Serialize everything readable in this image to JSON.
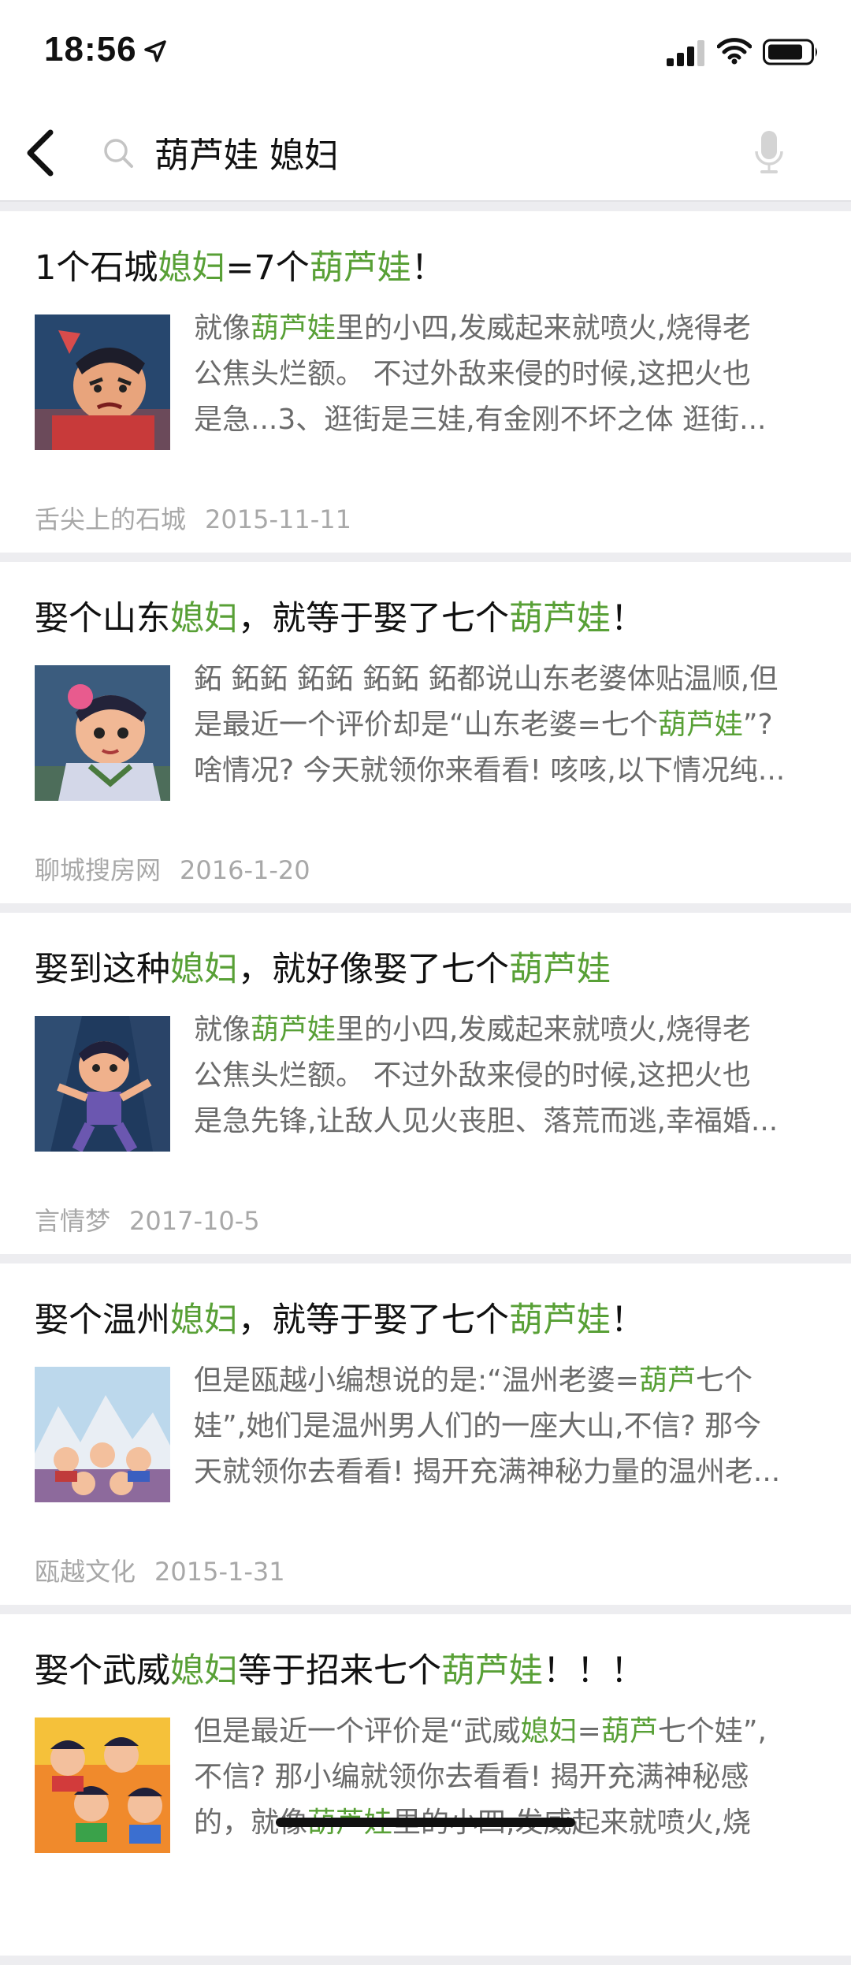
{
  "status": {
    "time": "18:56"
  },
  "search": {
    "query": "葫芦娃 媳妇"
  },
  "results": [
    {
      "title": [
        [
          "1个石城",
          false
        ],
        [
          "媳妇",
          true
        ],
        [
          "=7个",
          false
        ],
        [
          "葫芦娃",
          true
        ],
        [
          "！",
          false
        ]
      ],
      "snippet": [
        [
          [
            "就像",
            false
          ],
          [
            "葫芦娃",
            true
          ],
          [
            "里的小四,发威起来就喷火,烧得老",
            false
          ]
        ],
        [
          [
            "公焦头烂额。 不过外敌来侵的时候,这把火也",
            false
          ]
        ],
        [
          [
            "是急...3、逛街是三娃,有金刚不坏之体 逛街...",
            false
          ]
        ]
      ],
      "source": "舌尖上的石城",
      "date": "2015-11-11"
    },
    {
      "title": [
        [
          "娶个山东",
          false
        ],
        [
          "媳妇",
          true
        ],
        [
          "，就等于娶了七个",
          false
        ],
        [
          "葫芦娃",
          true
        ],
        [
          "！",
          false
        ]
      ],
      "snippet": [
        [
          [
            "鉐 鉐鉐 鉐鉐 鉐鉐 鉐都说山东老婆体贴温顺,但",
            false
          ]
        ],
        [
          [
            "是最近一个评价却是“山东老婆=七个",
            false
          ],
          [
            "葫芦娃",
            true
          ],
          [
            "”?",
            false
          ]
        ],
        [
          [
            "啥情况? 今天就领你来看看! 咳咳,以下情况纯...",
            false
          ]
        ]
      ],
      "source": "聊城搜房网",
      "date": "2016-1-20"
    },
    {
      "title": [
        [
          "娶到这种",
          false
        ],
        [
          "媳妇",
          true
        ],
        [
          "，就好像娶了七个",
          false
        ],
        [
          "葫芦娃",
          true
        ]
      ],
      "snippet": [
        [
          [
            "就像",
            false
          ],
          [
            "葫芦娃",
            true
          ],
          [
            "里的小四,发威起来就喷火,烧得老",
            false
          ]
        ],
        [
          [
            "公焦头烂额。 不过外敌来侵的时候,这把火也",
            false
          ]
        ],
        [
          [
            "是急先锋,让敌人见火丧胆、落荒而逃,幸福婚...",
            false
          ]
        ]
      ],
      "source": "言情梦",
      "date": "2017-10-5"
    },
    {
      "title": [
        [
          "娶个温州",
          false
        ],
        [
          "媳妇",
          true
        ],
        [
          "，就等于娶了七个",
          false
        ],
        [
          "葫芦娃",
          true
        ],
        [
          "！",
          false
        ]
      ],
      "snippet": [
        [
          [
            "但是瓯越小编想说的是:“温州老婆=",
            false
          ],
          [
            "葫芦",
            true
          ],
          [
            "七个",
            false
          ]
        ],
        [
          [
            "娃”,她们是温州男人们的一座大山,不信? 那今",
            false
          ]
        ],
        [
          [
            "天就领你去看看! 揭开充满神秘力量的温州老...",
            false
          ]
        ]
      ],
      "source": "瓯越文化",
      "date": "2015-1-31"
    },
    {
      "title": [
        [
          "娶个武威",
          false
        ],
        [
          "媳妇",
          true
        ],
        [
          "等于招来七个",
          false
        ],
        [
          "葫芦娃",
          true
        ],
        [
          "！！！",
          false
        ]
      ],
      "snippet": [
        [
          [
            "但是最近一个评价是“武威",
            false
          ],
          [
            "媳妇",
            true
          ],
          [
            "=",
            false
          ],
          [
            "葫芦",
            true
          ],
          [
            "七个娃”,",
            false
          ]
        ],
        [
          [
            "不信? 那小编就领你去看看! 揭开充满神秘感",
            false
          ]
        ],
        [
          [
            "的，就像",
            false
          ],
          [
            "葫芦娃",
            true
          ],
          [
            "里的小四,发威起来就喷火,烧",
            false
          ]
        ]
      ],
      "source": "",
      "date": ""
    }
  ],
  "colors": {
    "highlight": "#58a036",
    "snippet": "#6b6b6b",
    "meta": "#a8a8a8",
    "background": "#ededf0"
  },
  "icons": {
    "back": "chevron-left-icon",
    "search": "magnifier-icon",
    "mic": "microphone-icon",
    "location": "location-arrow-icon",
    "signal": "cellular-signal-icon",
    "wifi": "wifi-icon",
    "battery": "battery-icon"
  }
}
